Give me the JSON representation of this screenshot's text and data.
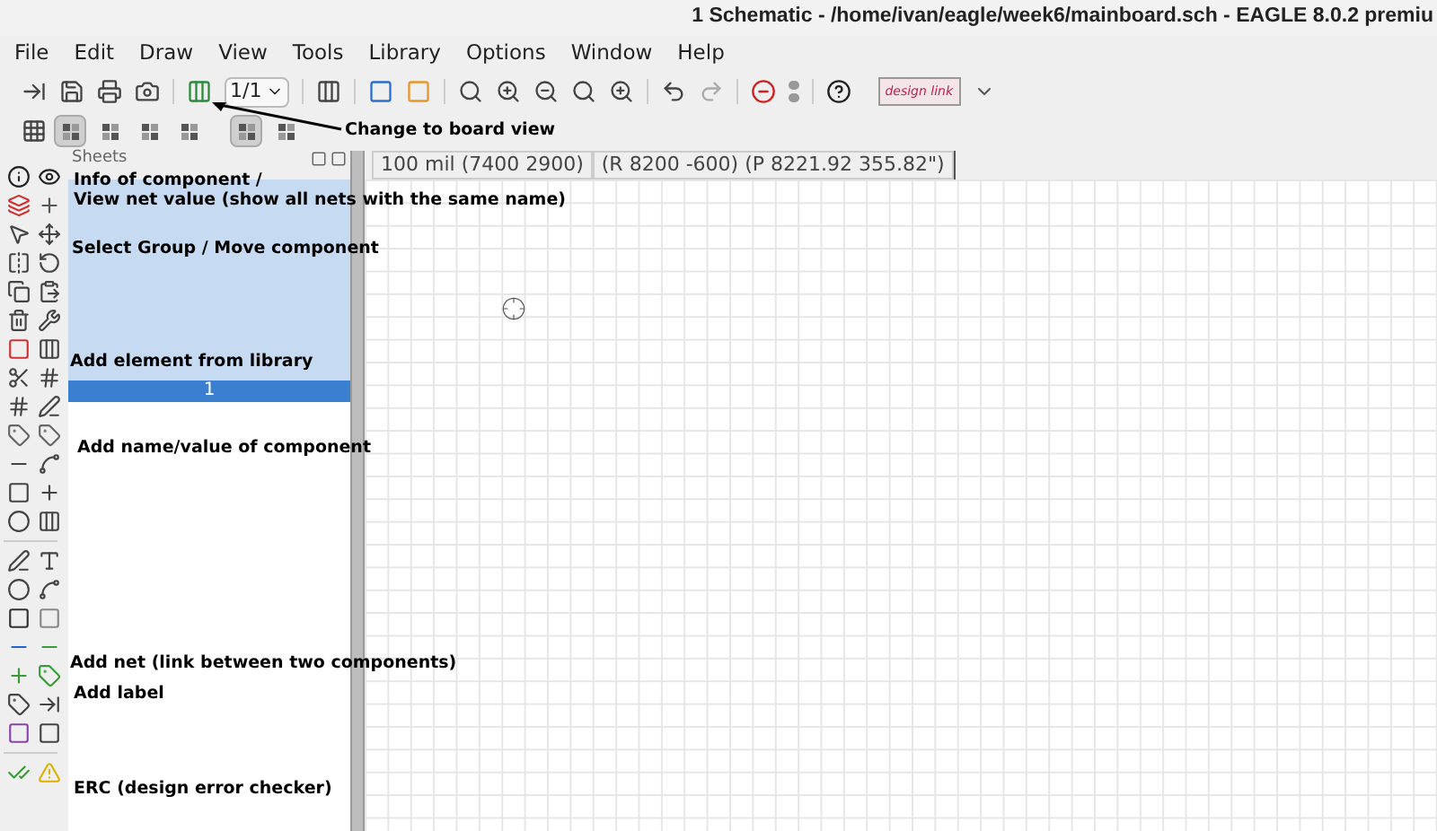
{
  "window": {
    "title": "1 Schematic - /home/ivan/eagle/week6/mainboard.sch - EAGLE 8.0.2 premiu"
  },
  "menu": [
    "File",
    "Edit",
    "Draw",
    "View",
    "Tools",
    "Library",
    "Options",
    "Window",
    "Help"
  ],
  "toolbar": {
    "page_select": "1/1",
    "logo_text": "design link"
  },
  "layout_buttons": [
    {
      "selected": true
    },
    {
      "selected": false
    },
    {
      "selected": false
    },
    {
      "selected": false
    },
    {
      "selected": true
    },
    {
      "selected": false
    }
  ],
  "sheets_panel": {
    "title": "Sheets",
    "sheets": [
      {
        "label": "1",
        "selected": true
      }
    ]
  },
  "coordinates": {
    "grid": "100 mil (7400 2900)",
    "position": "(R 8200 -600) (P 8221.92 355.82\")"
  },
  "annotations": [
    {
      "text": "Change to board view",
      "kind": "arrow"
    },
    {
      "text": "Info of component /",
      "kind": "plain"
    },
    {
      "text": "View net value (show all nets with the same name)",
      "kind": "plain"
    },
    {
      "text": "Select Group / Move component",
      "kind": "plain"
    },
    {
      "text": "Add element from library",
      "kind": "plain"
    },
    {
      "text": "Add name/value of component",
      "kind": "plain"
    },
    {
      "text": "Add net (link between two components)",
      "kind": "plain"
    },
    {
      "text": "Add label",
      "kind": "plain"
    },
    {
      "text": "ERC (design error checker)",
      "kind": "plain"
    }
  ]
}
